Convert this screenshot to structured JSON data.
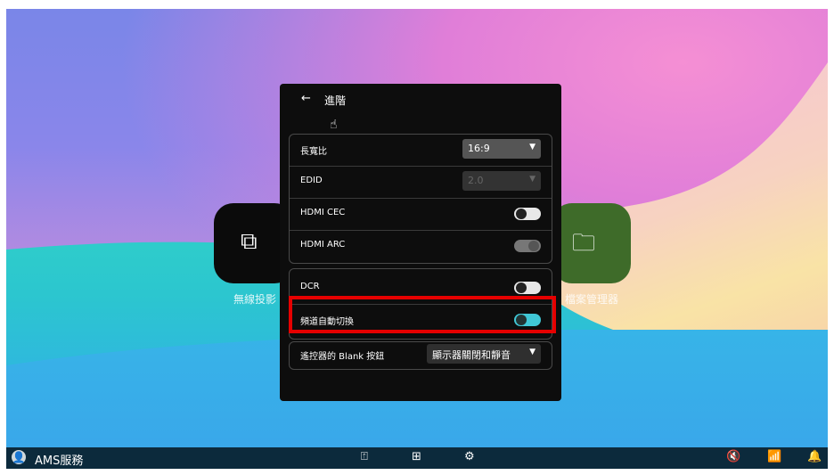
{
  "panel": {
    "title": "進階",
    "back_icon": "←",
    "rows_group1": [
      {
        "label": "長寬比",
        "type": "select",
        "value": "16:9"
      },
      {
        "label": "EDID",
        "type": "select-disabled",
        "value": "2.0"
      },
      {
        "label": "HDMI CEC",
        "type": "toggle",
        "state": "off"
      },
      {
        "label": "HDMI ARC",
        "type": "toggle",
        "state": "disabled"
      }
    ],
    "rows_group2": [
      {
        "label": "DCR",
        "type": "toggle",
        "state": "off"
      },
      {
        "label": "頻道自動切換",
        "type": "toggle",
        "state": "on"
      }
    ],
    "rows_group3": [
      {
        "label": "遙控器的 Blank 按鈕",
        "type": "select",
        "value": "顯示器關閉和靜音"
      }
    ]
  },
  "tiles": {
    "left_caption": "無線投影",
    "right_caption": "檔案管理器"
  },
  "taskbar": {
    "user_label": "AMS服務",
    "icons": [
      "cast-icon",
      "apps-icon",
      "settings-icon",
      "mute-icon",
      "wifi-icon",
      "bell-icon"
    ]
  },
  "colors": {
    "highlight": "#e60000",
    "toggle_on": "#40c7d6",
    "taskbar": "#0c2a3c"
  }
}
